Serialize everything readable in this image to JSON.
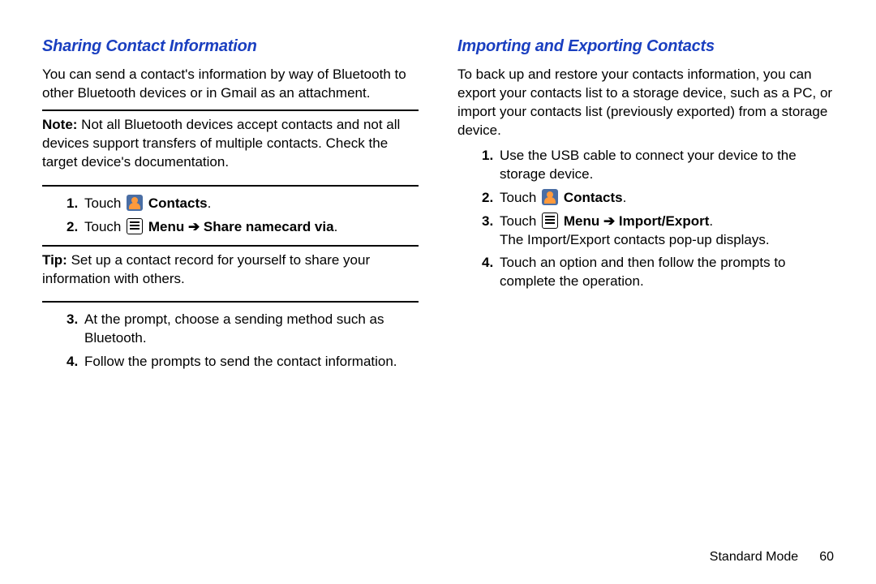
{
  "footer": {
    "mode": "Standard Mode",
    "page": "60"
  },
  "left": {
    "title": "Sharing Contact Information",
    "intro": "You can send a contact's information by way of Bluetooth to other Bluetooth devices or in Gmail as an attachment.",
    "note_label": "Note:",
    "note_body": " Not all Bluetooth devices accept contacts and not all devices support transfers of multiple contacts. Check the target device's documentation.",
    "steps_a": {
      "n1": "1.",
      "s1_touch": "Touch ",
      "s1_contacts": "Contacts",
      "s1_period": ".",
      "n2": "2.",
      "s2_touch": "Touch ",
      "s2_menu": "Menu",
      "s2_arrow": " ➔ ",
      "s2_share": "Share namecard via",
      "s2_period": "."
    },
    "tip_label": "Tip:",
    "tip_body": " Set up a contact record for yourself to share your information with others.",
    "steps_b": {
      "n3": "3.",
      "s3": "At the prompt, choose a sending method such as Bluetooth.",
      "n4": "4.",
      "s4": "Follow the prompts to send the contact information."
    }
  },
  "right": {
    "title": "Importing and Exporting Contacts",
    "intro": "To back up and restore your contacts information, you can export your contacts list to a storage device, such as a PC, or import your contacts list (previously exported) from a storage device.",
    "steps": {
      "n1": "1.",
      "s1": "Use the USB cable to connect your device to the storage device.",
      "n2": "2.",
      "s2_touch": "Touch ",
      "s2_contacts": "Contacts",
      "s2_period": ".",
      "n3": "3.",
      "s3_touch": "Touch ",
      "s3_menu": "Menu",
      "s3_arrow": " ➔ ",
      "s3_ie": "Import/Export",
      "s3_period": ".",
      "s3_line2": "The Import/Export contacts pop-up displays.",
      "n4": "4.",
      "s4": "Touch an option and then follow the prompts to complete the operation."
    }
  }
}
